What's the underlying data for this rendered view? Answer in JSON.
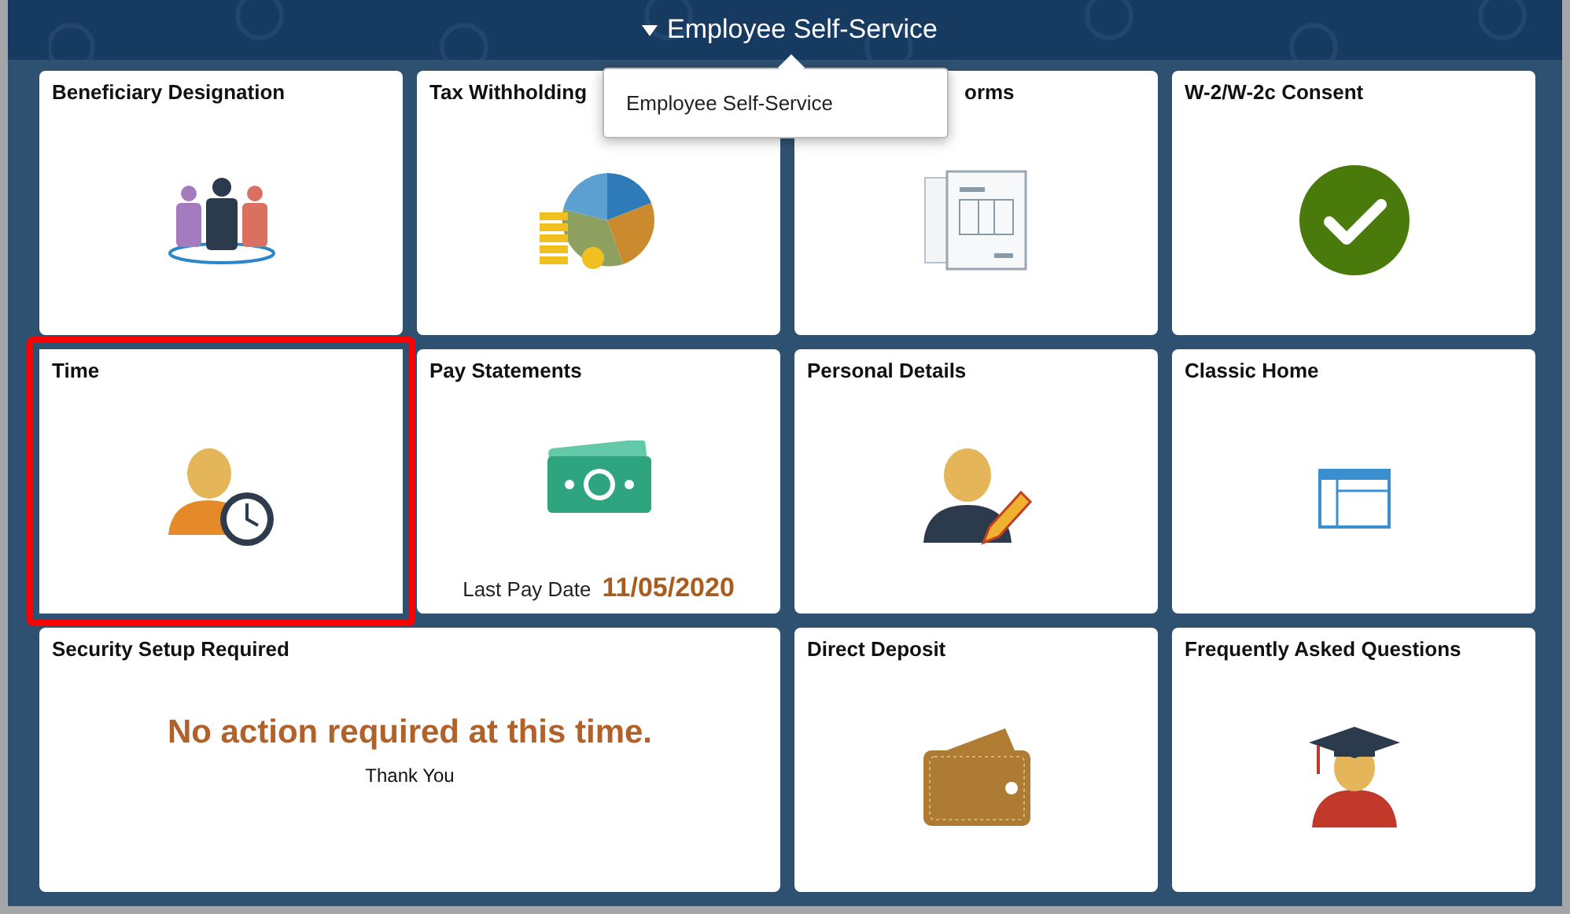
{
  "header": {
    "title": "Employee Self-Service",
    "expanded": true
  },
  "menu": {
    "items": [
      {
        "label": "Employee Self-Service"
      }
    ]
  },
  "tiles": [
    {
      "kind": "people",
      "title": "Beneficiary Designation",
      "highlighted": false,
      "title_cut": false
    },
    {
      "kind": "pie",
      "title": "Tax Withholding",
      "highlighted": false,
      "title_cut": false
    },
    {
      "kind": "forms",
      "title": "orms",
      "highlighted": false,
      "title_cut": true
    },
    {
      "kind": "check",
      "title": "W-2/W-2c Consent",
      "highlighted": false,
      "title_cut": false
    },
    {
      "kind": "time",
      "title": "Time",
      "highlighted": true,
      "title_cut": false
    },
    {
      "kind": "money",
      "title": "Pay Statements",
      "highlighted": false,
      "title_cut": false,
      "footer_label": "Last Pay Date",
      "footer_value": "11/05/2020"
    },
    {
      "kind": "person-edit",
      "title": "Personal Details",
      "highlighted": false,
      "title_cut": false
    },
    {
      "kind": "window",
      "title": "Classic Home",
      "highlighted": false,
      "title_cut": false
    },
    {
      "kind": "message",
      "title": "Security Setup Required",
      "highlighted": false,
      "title_cut": false,
      "message": "No action required at this time.",
      "subtext": "Thank You"
    },
    {
      "kind": "wallet",
      "title": "Direct Deposit",
      "highlighted": false,
      "title_cut": false
    },
    {
      "kind": "grad",
      "title": "Frequently Asked Questions",
      "highlighted": false,
      "title_cut": false
    }
  ]
}
